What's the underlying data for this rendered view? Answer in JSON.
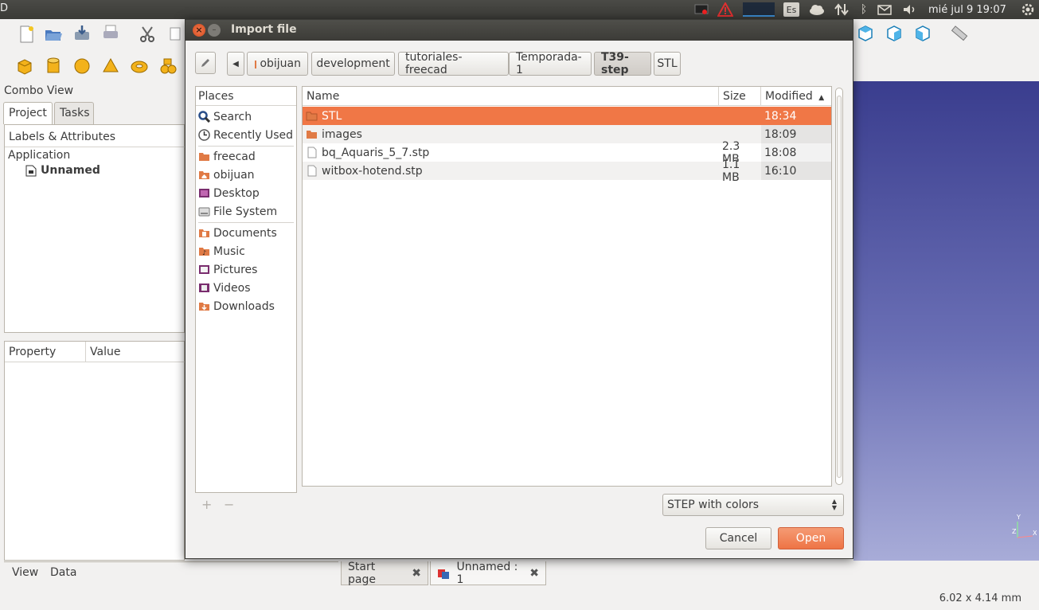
{
  "top_panel": {
    "keyboard_layout": "Es",
    "clock": "mié jul 9  19:07"
  },
  "freecad": {
    "combo_view_title": "Combo View",
    "tabs": {
      "project": "Project",
      "tasks": "Tasks"
    },
    "tree_header": "Labels & Attributes",
    "tree_application": "Application",
    "tree_document": "Unnamed",
    "property_columns": {
      "property": "Property",
      "value": "Value"
    },
    "view_tabs": {
      "view": "View",
      "data": "Data"
    },
    "doc_tabs": [
      {
        "label": "Start page"
      },
      {
        "label": "Unnamed : 1"
      }
    ],
    "status_dimensions": "6.02 x 4.14 mm",
    "axis_labels": {
      "y": "Y",
      "z": "Z",
      "x": "X"
    }
  },
  "dialog": {
    "title": "Import file",
    "breadcrumbs": [
      {
        "label": "obijuan",
        "home": true
      },
      {
        "label": "development"
      },
      {
        "label": "tutoriales-freecad"
      },
      {
        "label": "Temporada-1"
      },
      {
        "label": "T39-step",
        "active": true
      },
      {
        "label": "STL"
      }
    ],
    "places_header": "Places",
    "places": [
      {
        "label": "Search",
        "icon": "search-icon"
      },
      {
        "label": "Recently Used",
        "icon": "clock-icon"
      },
      {
        "label": "freecad",
        "icon": "folder-icon"
      },
      {
        "label": "obijuan",
        "icon": "home-folder-icon"
      },
      {
        "label": "Desktop",
        "icon": "desktop-icon"
      },
      {
        "label": "File System",
        "icon": "drive-icon"
      },
      {
        "label": "Documents",
        "icon": "documents-folder-icon"
      },
      {
        "label": "Music",
        "icon": "music-folder-icon"
      },
      {
        "label": "Pictures",
        "icon": "pictures-folder-icon"
      },
      {
        "label": "Videos",
        "icon": "videos-folder-icon"
      },
      {
        "label": "Downloads",
        "icon": "downloads-folder-icon"
      }
    ],
    "add_place": "+",
    "remove_place": "−",
    "columns": {
      "name": "Name",
      "size": "Size",
      "modified": "Modified"
    },
    "files": [
      {
        "name": "STL",
        "size": "",
        "modified": "18:34",
        "type": "folder",
        "selected": true
      },
      {
        "name": "images",
        "size": "",
        "modified": "18:09",
        "type": "folder"
      },
      {
        "name": "bq_Aquaris_5_7.stp",
        "size": "2.3 MB",
        "modified": "18:08",
        "type": "file"
      },
      {
        "name": "witbox-hotend.stp",
        "size": "1.1 MB",
        "modified": "16:10",
        "type": "file"
      }
    ],
    "filter": "STEP with colors",
    "cancel": "Cancel",
    "open": "Open"
  },
  "colors": {
    "selection": "#f07746",
    "accent_button": "#ee7445",
    "titlebar": "#3c3b37"
  }
}
